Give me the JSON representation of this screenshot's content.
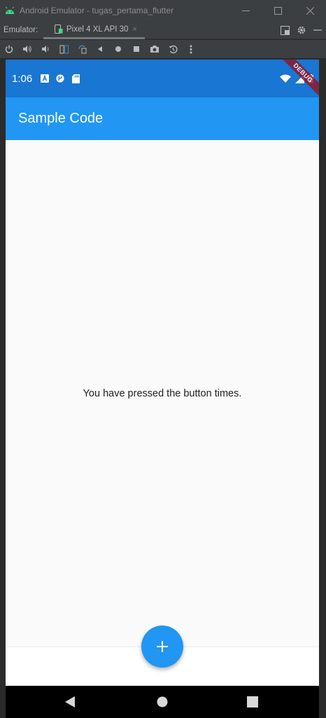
{
  "window": {
    "title": "Android Emulator - tugas_pertama_flutter",
    "controls": [
      "minimize-icon",
      "maximize-icon",
      "close-icon"
    ]
  },
  "emulator_bar": {
    "label": "Emulator:",
    "tab_label": "Pixel 4 XL API 30",
    "tab_close": "×"
  },
  "toolbar": {
    "tools": [
      "power-icon",
      "volume-up-icon",
      "volume-down-icon",
      "rotate-left-icon",
      "rotate-right-icon",
      "back-icon",
      "home-icon",
      "overview-icon",
      "camera-icon",
      "snapshot-icon",
      "more-icon"
    ]
  },
  "status_bar": {
    "time": "1:06",
    "debug_banner": "DEBUG"
  },
  "app_bar": {
    "title": "Sample Code"
  },
  "body": {
    "counter_text": "You have pressed the button times."
  },
  "fab": {
    "icon": "add-icon",
    "label": "+"
  },
  "colors": {
    "status_bar": "#1976d2",
    "app_bar": "#2196f3",
    "fab": "#2196f3",
    "background": "#fafafa"
  }
}
